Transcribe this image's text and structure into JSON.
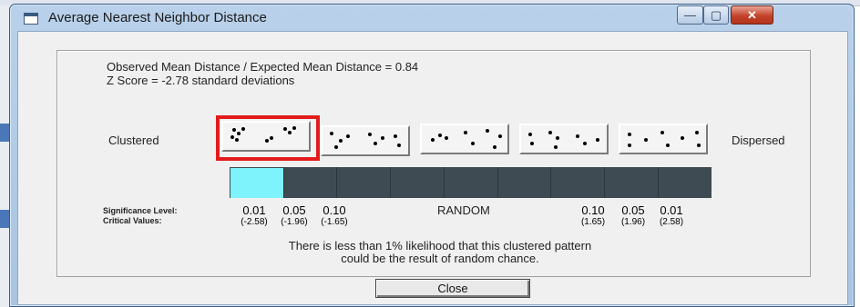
{
  "window": {
    "title": "Average Nearest Neighbor Distance"
  },
  "controls": {
    "minimize": "—",
    "maximize": "▢",
    "close": "✕"
  },
  "stats": {
    "ratio_line": "Observed Mean Distance / Expected Mean Distance = 0.84",
    "z_line": "Z Score = -2.78 standard deviations"
  },
  "labels": {
    "clustered": "Clustered",
    "dispersed": "Dispersed"
  },
  "patterns": {
    "selected_index": 0,
    "count": 5
  },
  "scale": {
    "cells": 9,
    "active_cell": 0,
    "active_color": "#7ff3fb",
    "bar_color": "#3f4b52"
  },
  "significance": {
    "row1_label": "Significance Level:",
    "row2_label": "Critical Values:",
    "random_label": "RANDOM",
    "columns": [
      {
        "level": "0.01",
        "critical": "(-2.58)"
      },
      {
        "level": "0.05",
        "critical": "(-1.96)"
      },
      {
        "level": "0.10",
        "critical": "(-1.65)"
      },
      {
        "level": "0.10",
        "critical": "(1.65)"
      },
      {
        "level": "0.05",
        "critical": "(1.96)"
      },
      {
        "level": "0.01",
        "critical": "(2.58)"
      }
    ]
  },
  "message": {
    "line1": "There is less than 1% likelihood that this clustered pattern",
    "line2": "could be the result of random chance."
  },
  "buttons": {
    "close": "Close"
  },
  "colors": {
    "selection_frame": "#e31b1b",
    "title_close_button": "#c3432a"
  }
}
